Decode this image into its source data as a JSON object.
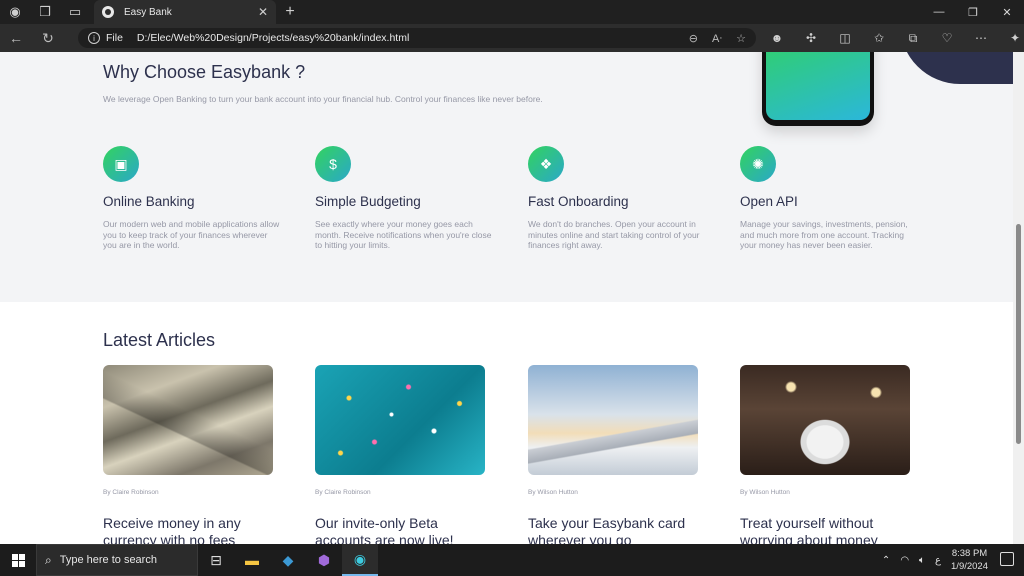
{
  "browser": {
    "tab_title": "Easy Bank",
    "new_tab": "+",
    "url_prefix": "File",
    "url": "D:/Elec/Web%20Design/Projects/easy%20bank/index.html"
  },
  "why": {
    "title": "Why Choose Easybank ?",
    "text": "We leverage Open Banking to turn your bank account into your financial hub. Control your finances like never before.",
    "features": [
      {
        "icon": "phone-banking-icon",
        "title": "Online Banking",
        "desc": "Our modern web and mobile applications allow you to keep track of your finances wherever you are in the world."
      },
      {
        "icon": "budget-icon",
        "title": "Simple Budgeting",
        "desc": "See exactly where your money goes each month. Receive notifications when you're close to hitting your limits."
      },
      {
        "icon": "onboarding-icon",
        "title": "Fast Onboarding",
        "desc": "We don't do branches. Open your account in minutes online and start taking control of your finances right away."
      },
      {
        "icon": "api-icon",
        "title": "Open API",
        "desc": "Manage your savings, investments, pension, and much more from one account. Tracking your money has never been easier."
      }
    ]
  },
  "articles": {
    "title": "Latest Articles",
    "items": [
      {
        "author": "By Claire Robinson",
        "title": "Receive money in any currency with no fees"
      },
      {
        "author": "By Claire Robinson",
        "title": "Our invite-only Beta accounts are now live!"
      },
      {
        "author": "By Wilson Hutton",
        "title": "Take your Easybank card wherever you go"
      },
      {
        "author": "By Wilson Hutton",
        "title": "Treat yourself without worrying about money"
      }
    ]
  },
  "taskbar": {
    "search_placeholder": "Type here to search",
    "time": "8:38 PM",
    "date": "1/9/2024",
    "lang": "ع"
  }
}
